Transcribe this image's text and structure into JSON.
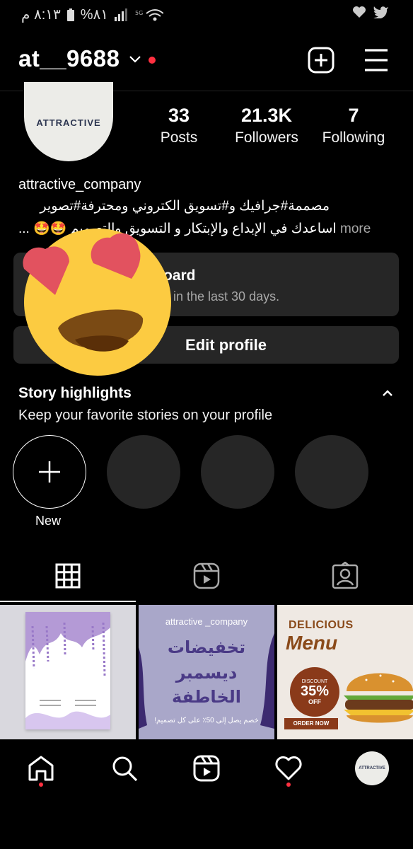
{
  "status_bar": {
    "time": "٨:١٣ م",
    "battery": "%٨١",
    "icons": [
      "notification-icon",
      "signal-icon",
      "battery-icon",
      "wifi-icon",
      "heart-icon",
      "twitter-icon"
    ]
  },
  "header": {
    "username": "at__9688",
    "icons": [
      "chevron-down-icon",
      "create-post-icon",
      "menu-icon"
    ]
  },
  "profile": {
    "avatar_text": "ATTRACTIVE",
    "stats": [
      {
        "value": "33",
        "label": "Posts"
      },
      {
        "value": "21.3K",
        "label": "Followers"
      },
      {
        "value": "7",
        "label": "Following"
      }
    ],
    "name": "attractive_company",
    "bio_line1": "مصممة#جرافيك و#تسويق الكتروني ومحترفة#تصوير",
    "bio_line2": "🤩🤩 اساعدك في  الإبداع والإبتكار و التسويق والتصميم",
    "bio_prefix": "...",
    "more": "more"
  },
  "dashboard": {
    "title": "oard",
    "subtitle": "in the last 30 days."
  },
  "edit_profile": "Edit profile",
  "highlights": {
    "title": "Story highlights",
    "subtitle": "Keep your favorite stories on your profile",
    "new_label": "New"
  },
  "posts": {
    "post2": {
      "handle": "attractive _company",
      "lines": [
        "تخفيضات",
        "ديسمبر",
        "الخاطفة"
      ],
      "footer": "خصم يصل إلى 50٪ على كل تصميم!"
    },
    "post3": {
      "title1": "DELICIOUS",
      "title2": "Menu",
      "discount_label": "DISCOUNT",
      "percent": "35%",
      "off": "OFF",
      "order": "ORDER NOW"
    }
  },
  "bottom_nav": {
    "avatar_text": "ATTRACTIVE",
    "icons": [
      "home-icon",
      "search-icon",
      "reels-icon",
      "activity-heart-icon",
      "profile-avatar"
    ]
  },
  "colors": {
    "background": "#000000",
    "card": "#262626",
    "notification": "#ff3040",
    "secondary_text": "#a8a8a8"
  }
}
